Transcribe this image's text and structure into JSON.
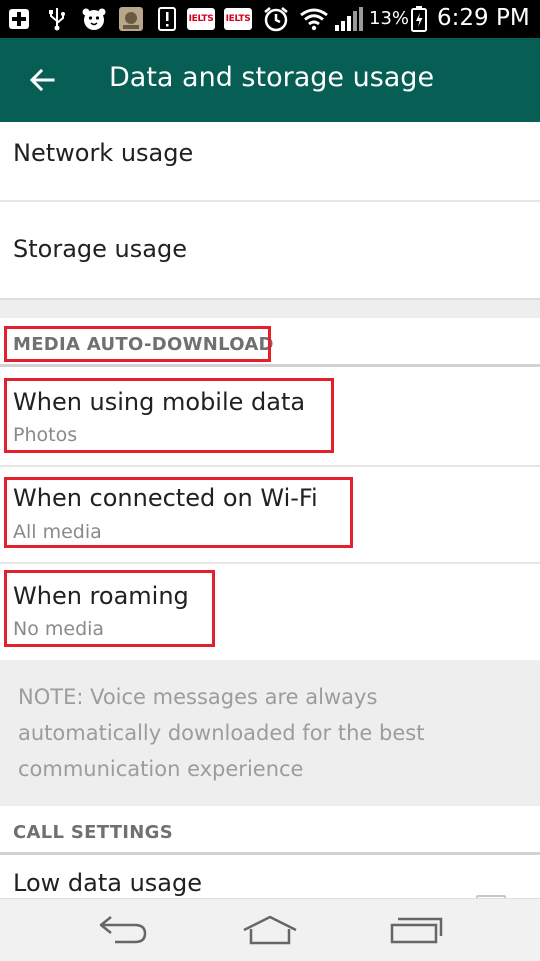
{
  "status_bar": {
    "ielts_1": "IELTS",
    "ielts_2": "IELTS",
    "battery_percent": "13%",
    "time": "6:29 PM"
  },
  "app_bar": {
    "title": "Data and storage usage"
  },
  "items": {
    "network_usage": "Network usage",
    "storage_usage": "Storage usage"
  },
  "media_section": {
    "header": "MEDIA AUTO-DOWNLOAD",
    "mobile": {
      "label": "When using mobile data",
      "value": "Photos"
    },
    "wifi": {
      "label": "When connected on Wi-Fi",
      "value": "All media"
    },
    "roaming": {
      "label": "When roaming",
      "value": "No media"
    }
  },
  "note": "NOTE: Voice messages are always automatically downloaded for the best communication experience",
  "call_section": {
    "header": "CALL SETTINGS",
    "low_data": "Low data usage"
  },
  "colors": {
    "app_bar": "#075e54",
    "highlight": "#e3202c"
  },
  "icons": [
    "plus-icon",
    "usb-icon",
    "tiger-icon",
    "photo-icon",
    "alert-icon",
    "alarm-icon",
    "wifi-icon",
    "signal-icon",
    "battery-icon",
    "back-arrow-icon",
    "nav-back-icon",
    "nav-home-icon",
    "nav-recents-icon"
  ]
}
